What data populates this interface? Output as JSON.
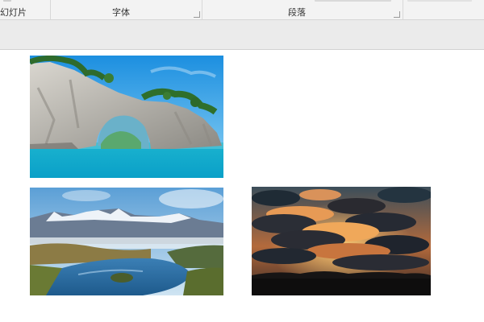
{
  "ribbon": {
    "groups": [
      {
        "label": "幻灯片"
      },
      {
        "label": "字体"
      },
      {
        "label": "段落"
      }
    ]
  },
  "slide": {
    "images": [
      {
        "name": "coastal-rock-arch-photo"
      },
      {
        "name": "mountain-lake-valley-photo"
      },
      {
        "name": "sunset-clouds-photo"
      }
    ]
  }
}
